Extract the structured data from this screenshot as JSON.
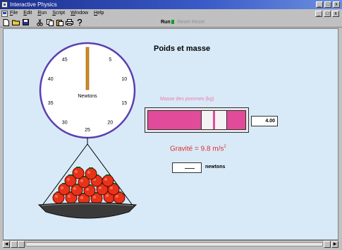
{
  "window": {
    "title": "Interactive Physics",
    "min_glyph": "_",
    "max_glyph": "□",
    "close_glyph": "x"
  },
  "menubar": {
    "items": [
      "File",
      "Edit",
      "Run",
      "Script",
      "Window",
      "Help"
    ],
    "mdi_glyphs": [
      "_",
      "□",
      "x"
    ]
  },
  "toolbar": {
    "run_label": "Run",
    "disabled_label": "Reset  Reset"
  },
  "simulation": {
    "title": "Poids et masse",
    "mass_label": "Masse des pommes (kg)",
    "mass_value": "4.00",
    "mass_slider_fraction": 0.58,
    "gravity_text": "Gravité = 9.8 m/s",
    "gravity_exponent": "2",
    "answer_unit": "newtons",
    "dial": {
      "unit_label": "Newtons",
      "tick_labels": [
        "0",
        "5",
        "10",
        "15",
        "20",
        "25",
        "30",
        "35",
        "40",
        "45"
      ],
      "needle_value": 0,
      "max_value": 50
    }
  },
  "colors": {
    "canvas_bg": "#d8eaf8",
    "slider_fill": "#e14b9a",
    "gravity_text": "#e03030",
    "dial_rim": "#5a3fb0",
    "needle": "#d08a20",
    "apple": "#e8321a"
  },
  "scrollbar": {
    "left_glyph": "◀",
    "right_glyph": "▶"
  }
}
